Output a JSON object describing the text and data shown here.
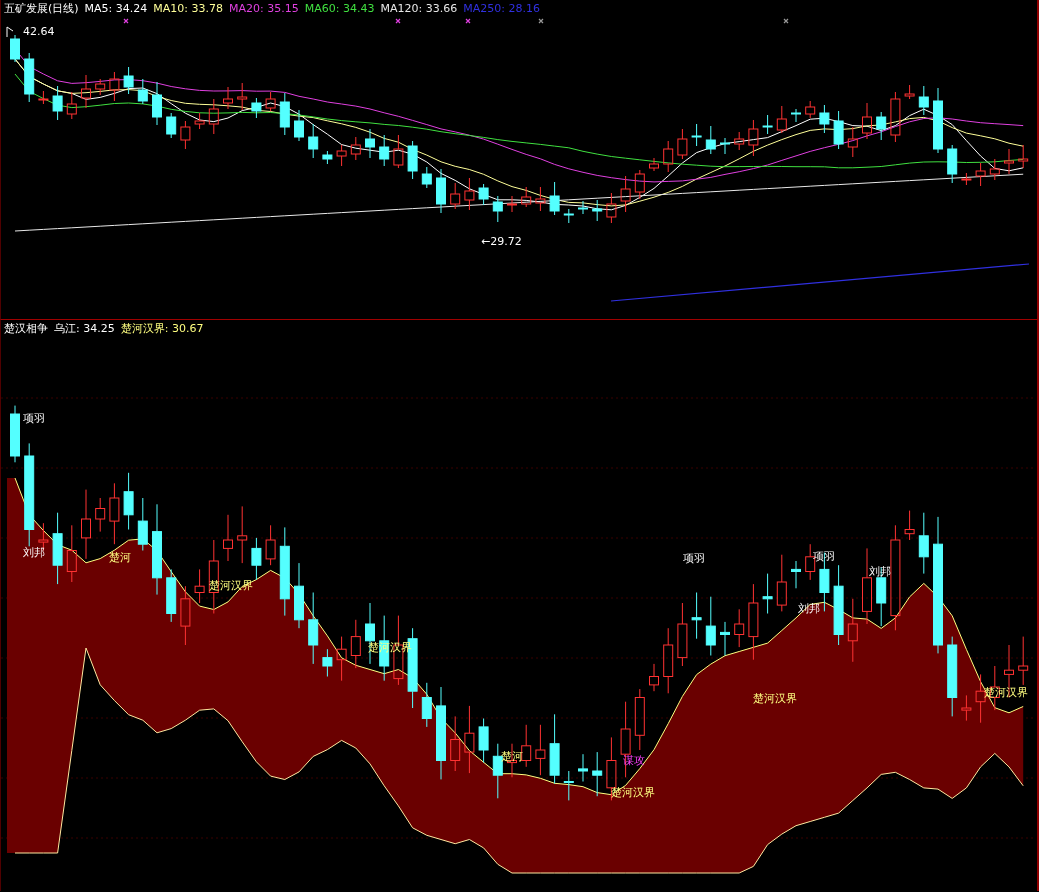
{
  "price_panel": {
    "title": "五矿发展(日线)",
    "legend": [
      {
        "label": "MA5: 34.24",
        "color": "#ffffff"
      },
      {
        "label": "MA10: 33.78",
        "color": "#ffff99"
      },
      {
        "label": "MA20: 35.15",
        "color": "#e040e0"
      },
      {
        "label": "MA60: 34.43",
        "color": "#40e040"
      },
      {
        "label": "MA120: 33.66",
        "color": "#e8e8e8"
      },
      {
        "label": "MA250: 28.16",
        "color": "#3030e0"
      }
    ],
    "high_marker": "42.64",
    "low_marker": "←29.72"
  },
  "indicator_panel": {
    "title": "楚汉相争",
    "legend": [
      {
        "label": "乌江: 34.25",
        "color": "#ffffff"
      },
      {
        "label": "楚河汉界: 30.67",
        "color": "#ffff80"
      }
    ],
    "labels": [
      {
        "text": "项羽",
        "kind": "xiangyu"
      },
      {
        "text": "刘邦",
        "kind": "liubang"
      },
      {
        "text": "楚河",
        "kind": "chuhe"
      },
      {
        "text": "楚河汉界",
        "kind": "chuhe"
      },
      {
        "text": "楚河汉界",
        "kind": "chuhe"
      },
      {
        "text": "楚河",
        "kind": "chuhe"
      },
      {
        "text": "谋攻",
        "kind": "mougong"
      },
      {
        "text": "楚河汉界",
        "kind": "chuhe"
      },
      {
        "text": "项羽",
        "kind": "xiangyu"
      },
      {
        "text": "楚河汉界",
        "kind": "chuhe"
      },
      {
        "text": "项羽",
        "kind": "xiangyu"
      },
      {
        "text": "刘邦",
        "kind": "liubang"
      },
      {
        "text": "刘邦",
        "kind": "liubang"
      },
      {
        "text": "楚河汉界",
        "kind": "chuhe"
      }
    ]
  }
}
